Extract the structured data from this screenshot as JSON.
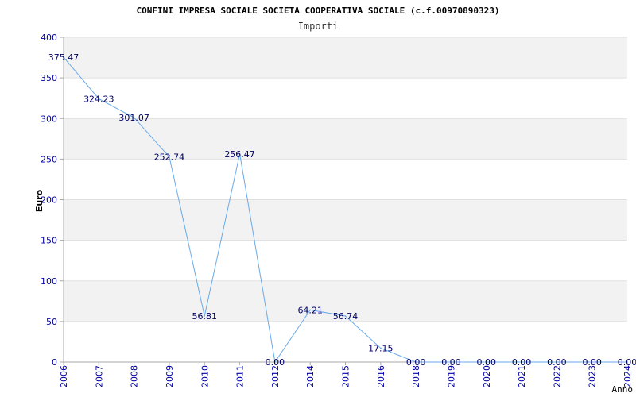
{
  "chart_data": {
    "type": "line",
    "title": "CONFINI IMPRESA SOCIALE SOCIETA COOPERATIVA SOCIALE (c.f.00970890323)",
    "subtitle": "Importi",
    "xlabel": "Anno",
    "ylabel": "Euro",
    "ylim": [
      0,
      400
    ],
    "yticks": [
      "0",
      "50",
      "100",
      "150",
      "200",
      "250",
      "300",
      "350",
      "400"
    ],
    "grid": true,
    "categories": [
      "2006",
      "2007",
      "2008",
      "2009",
      "2010",
      "2011",
      "2012",
      "2014",
      "2015",
      "2016",
      "2018",
      "2019",
      "2020",
      "2021",
      "2022",
      "2023",
      "2024"
    ],
    "series": [
      {
        "values": [
          375.47,
          324.23,
          301.07,
          252.74,
          56.81,
          256.47,
          0.0,
          64.21,
          56.74,
          17.15,
          0.0,
          0.0,
          0.0,
          0.0,
          0.0,
          0.0,
          0.0
        ],
        "labels": [
          "375.47",
          "324.23",
          "301.07",
          "252.74",
          "56.81",
          "256.47",
          "0.00",
          "64.21",
          "56.74",
          "17.15",
          "0.00",
          "0.00",
          "0.00",
          "0.00",
          "0.00",
          "0.00",
          "0.00"
        ],
        "color": "#6aaae8"
      }
    ],
    "band_color": "#f2f2f2",
    "axis_color": "#aaaaaa",
    "tick_color": "#0000aa"
  }
}
